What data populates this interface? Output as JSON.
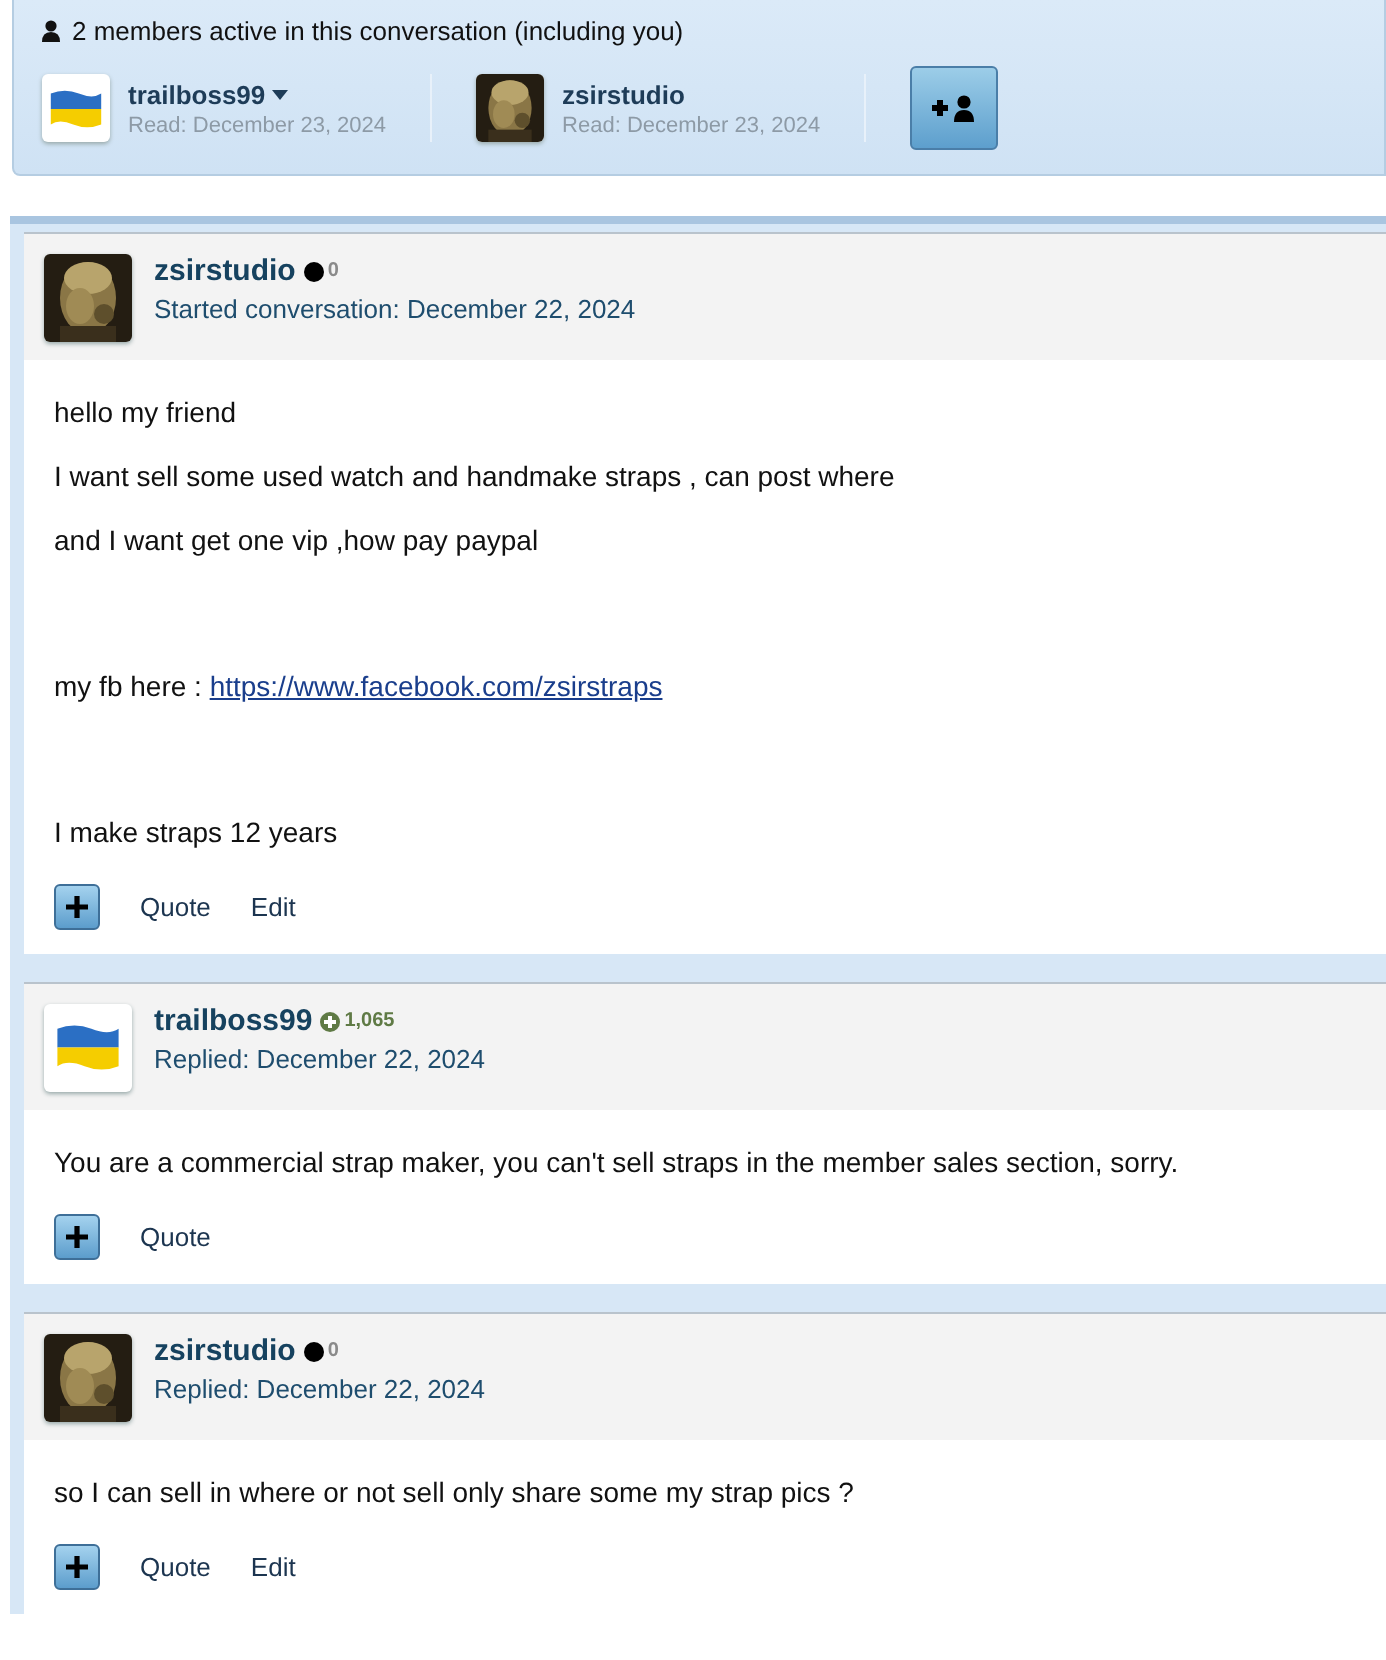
{
  "participants_bar": {
    "summary": "2 members active in this conversation (including you)",
    "participants": [
      {
        "name": "trailboss99",
        "avatar": {
          "kind": "flag"
        },
        "has_menu": true,
        "read": "Read: December 23, 2024"
      },
      {
        "name": "zsirstudio",
        "avatar": {
          "kind": "picture"
        },
        "has_menu": false,
        "read": "Read: December 23, 2024"
      }
    ]
  },
  "messages": [
    {
      "author": "zsirstudio",
      "avatar": {
        "kind": "picture"
      },
      "reputation": {
        "kind": "dot",
        "value": "0"
      },
      "meta": "Started conversation: December 22, 2024",
      "sections": [
        [
          {
            "text": "hello my friend"
          },
          {
            "text": "I want sell some used watch and handmake straps , can post where"
          },
          {
            "text": "and I want get one vip ,how pay paypal"
          }
        ],
        [
          {
            "text": "my fb here :",
            "link": "https://www.facebook.com/zsirstraps"
          }
        ],
        [
          {
            "text": "I make straps 12 years"
          }
        ]
      ],
      "actions": [
        "Quote",
        "Edit"
      ]
    },
    {
      "author": "trailboss99",
      "avatar": {
        "kind": "flag"
      },
      "reputation": {
        "kind": "plus",
        "value": "1,065"
      },
      "meta": "Replied: December 22, 2024",
      "sections": [
        [
          {
            "text": "You are a commercial strap maker, you can't sell straps in the member sales section, sorry."
          }
        ]
      ],
      "actions": [
        "Quote"
      ]
    },
    {
      "author": "zsirstudio",
      "avatar": {
        "kind": "picture"
      },
      "reputation": {
        "kind": "dot",
        "value": "0"
      },
      "meta": "Replied: December 22, 2024",
      "sections": [
        [
          {
            "text": "so I can sell in where or not sell only share some my strap pics ?"
          }
        ]
      ],
      "actions": [
        "Quote",
        "Edit"
      ]
    }
  ]
}
